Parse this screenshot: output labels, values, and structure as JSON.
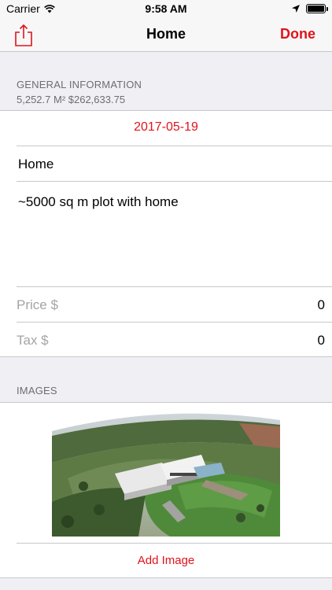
{
  "status": {
    "carrier": "Carrier",
    "time": "9:58 AM",
    "battery_level": 1.0
  },
  "nav": {
    "title": "Home",
    "done_label": "Done",
    "share_icon": "share-icon"
  },
  "general": {
    "header": "GENERAL INFORMATION",
    "summary": "5,252.7 M² $262,633.75",
    "date": "2017-05-19",
    "name": "Home",
    "notes": "~5000 sq m plot with home",
    "price_label": "Price $",
    "price_value": "0",
    "tax_label": "Tax $",
    "tax_value": "0"
  },
  "images": {
    "header": "IMAGES",
    "add_label": "Add Image"
  },
  "colors": {
    "accent": "#e0131b",
    "background": "#efeff4",
    "label_gray": "#a4a4a8"
  }
}
